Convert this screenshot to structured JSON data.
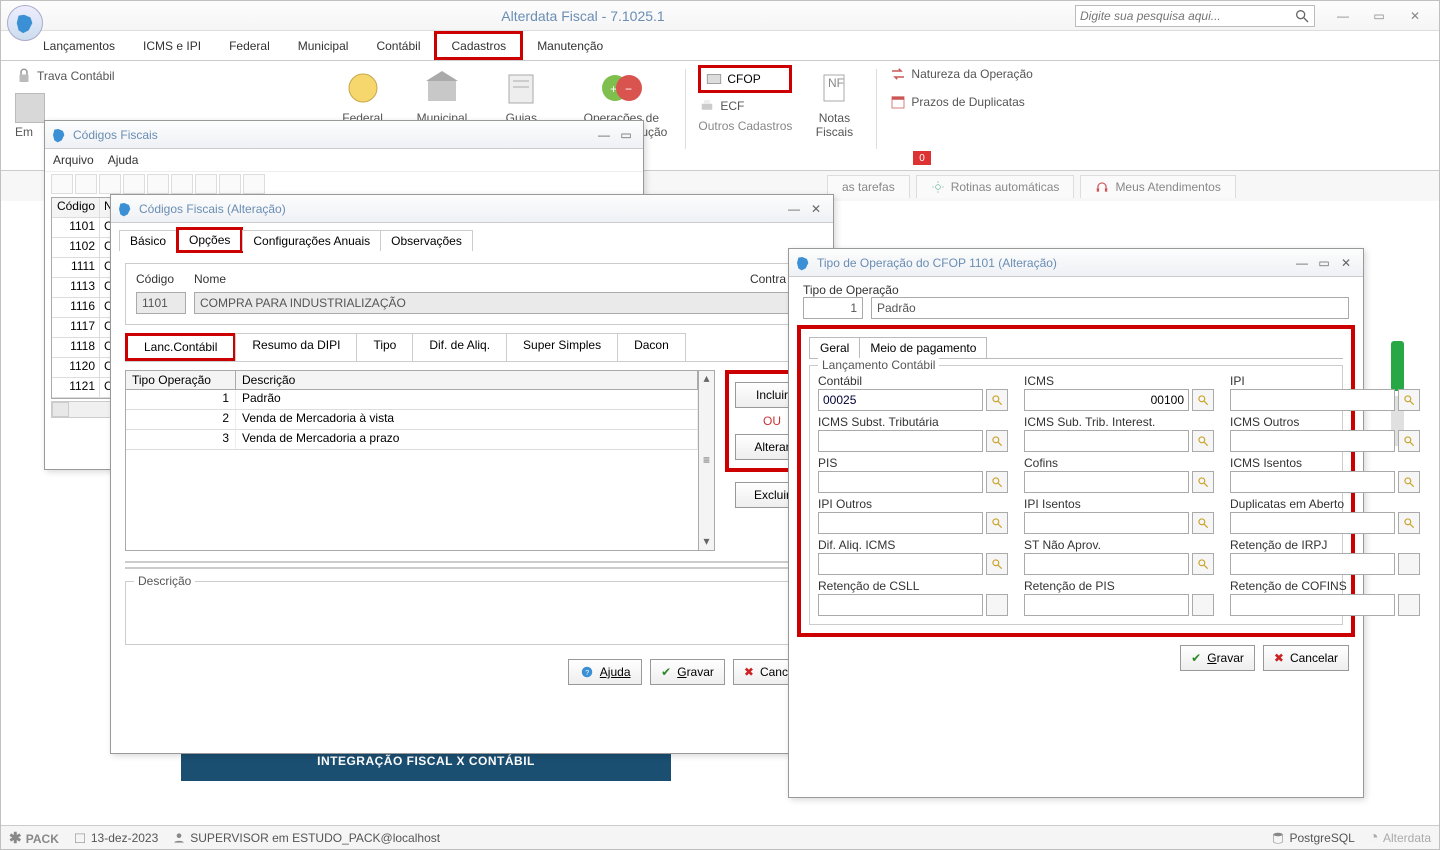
{
  "app": {
    "title": "Alterdata Fiscal - 7.1025.1",
    "search_placeholder": "Digite sua pesquisa aqui..."
  },
  "menubar": [
    "Lançamentos",
    "ICMS e IPI",
    "Federal",
    "Municipal",
    "Contábil",
    "Cadastros",
    "Manutenção"
  ],
  "menubar_active": "Cadastros",
  "ribbon": {
    "trava": "Trava Contábil",
    "federal": "Federal",
    "municipal": "Municipal",
    "guias": "Guias",
    "operacoes": "Operações de\nReceita/Dedução",
    "outros": "Outros Cadastros",
    "cfop": "CFOP",
    "ecf": "ECF",
    "notas": "Notas\nFiscais",
    "natureza": "Natureza da Operação",
    "prazos": "Prazos de Duplicatas",
    "badge": "0"
  },
  "tabs": {
    "tarefas": "as tarefas",
    "rotinas": "Rotinas automáticas",
    "atend": "Meus Atendimentos"
  },
  "codfiscais_window": {
    "title": "Códigos Fiscais",
    "menu": [
      "Arquivo",
      "Ajuda"
    ],
    "headers": [
      "Código",
      "N"
    ],
    "rows": [
      {
        "codigo": "1101",
        "n": "C"
      },
      {
        "codigo": "1102",
        "n": "C"
      },
      {
        "codigo": "1111",
        "n": "C"
      },
      {
        "codigo": "1113",
        "n": "C"
      },
      {
        "codigo": "1116",
        "n": "C"
      },
      {
        "codigo": "1117",
        "n": "C"
      },
      {
        "codigo": "1118",
        "n": "C"
      },
      {
        "codigo": "1120",
        "n": "C"
      },
      {
        "codigo": "1121",
        "n": "C"
      }
    ]
  },
  "cfa_window": {
    "title": "Códigos Fiscais (Alteração)",
    "tabs": [
      "Básico",
      "Opções",
      "Configurações Anuais",
      "Observações"
    ],
    "active_tab": "Opções",
    "codigo_label": "Código",
    "codigo_value": "1101",
    "nome_label": "Nome",
    "nome_value": "COMPRA PARA INDUSTRIALIZAÇÃO",
    "contra_label": "Contra Par",
    "subtabs": [
      "Lanc.Contábil",
      "Resumo da DIPI",
      "Tipo",
      "Dif. de Aliq.",
      "Super Simples",
      "Dacon"
    ],
    "active_subtab": "Lanc.Contábil",
    "op_headers": [
      "Tipo Operação",
      "Descrição"
    ],
    "op_rows": [
      {
        "t": "1",
        "d": "Padrão"
      },
      {
        "t": "2",
        "d": "Venda de Mercadoria à vista"
      },
      {
        "t": "3",
        "d": "Venda de Mercadoria a prazo"
      }
    ],
    "btn_incluir": "Incluir",
    "ou": "OU",
    "btn_alterar": "Alterar",
    "btn_excluir": "Excluir",
    "descricao_label": "Descrição",
    "ajuda": "Ajuda",
    "gravar": "Gravar",
    "cancelar": "Cancelar"
  },
  "tow": {
    "title": "Tipo de Operação do CFOP  1101 (Alteração)",
    "tipo_label": "Tipo de Operação",
    "tipo_num": "1",
    "tipo_nome": "Padrão",
    "tabs": [
      "Geral",
      "Meio de pagamento"
    ],
    "legend": "Lançamento Contábil",
    "fields": [
      {
        "k": "contabil",
        "label": "Contábil",
        "value": "00025",
        "lookup": true,
        "selected": true
      },
      {
        "k": "icms",
        "label": "ICMS",
        "value": "00100",
        "lookup": true
      },
      {
        "k": "ipi",
        "label": "IPI",
        "value": "",
        "lookup": true
      },
      {
        "k": "icms_st",
        "label": "ICMS Subst. Tributária",
        "value": "",
        "lookup": true
      },
      {
        "k": "icms_sti",
        "label": "ICMS Sub. Trib. Interest.",
        "value": "",
        "lookup": true
      },
      {
        "k": "icms_out",
        "label": "ICMS Outros",
        "value": "",
        "lookup": true
      },
      {
        "k": "pis",
        "label": "PIS",
        "value": "",
        "lookup": true
      },
      {
        "k": "cofins",
        "label": "Cofins",
        "value": "",
        "lookup": true
      },
      {
        "k": "icms_ise",
        "label": "ICMS Isentos",
        "value": "",
        "lookup": true
      },
      {
        "k": "ipi_out",
        "label": "IPI Outros",
        "value": "",
        "lookup": true
      },
      {
        "k": "ipi_ise",
        "label": "IPI Isentos",
        "value": "",
        "lookup": true
      },
      {
        "k": "dup",
        "label": "Duplicatas em Aberto",
        "value": "",
        "lookup": true
      },
      {
        "k": "dif",
        "label": "Dif. Aliq. ICMS",
        "value": "",
        "lookup": true
      },
      {
        "k": "st_na",
        "label": "ST Não Aprov.",
        "value": "",
        "lookup": true
      },
      {
        "k": "ret_irpj",
        "label": "Retenção de IRPJ",
        "value": "",
        "lookup": false
      },
      {
        "k": "ret_csll",
        "label": "Retenção de CSLL",
        "value": "",
        "lookup": false
      },
      {
        "k": "ret_pis",
        "label": "Retenção de PIS",
        "value": "",
        "lookup": false
      },
      {
        "k": "ret_cofins",
        "label": "Retenção de COFINS",
        "value": "",
        "lookup": false
      }
    ],
    "gravar": "Gravar",
    "cancelar": "Cancelar"
  },
  "content_band": "INTEGRAÇÃO FISCAL X CONTÁBIL",
  "status": {
    "pack": "PACK",
    "date": "13-dez-2023",
    "user": "SUPERVISOR em ESTUDO_PACK@localhost",
    "db": "PostgreSQL",
    "brand": "Alterdata"
  }
}
